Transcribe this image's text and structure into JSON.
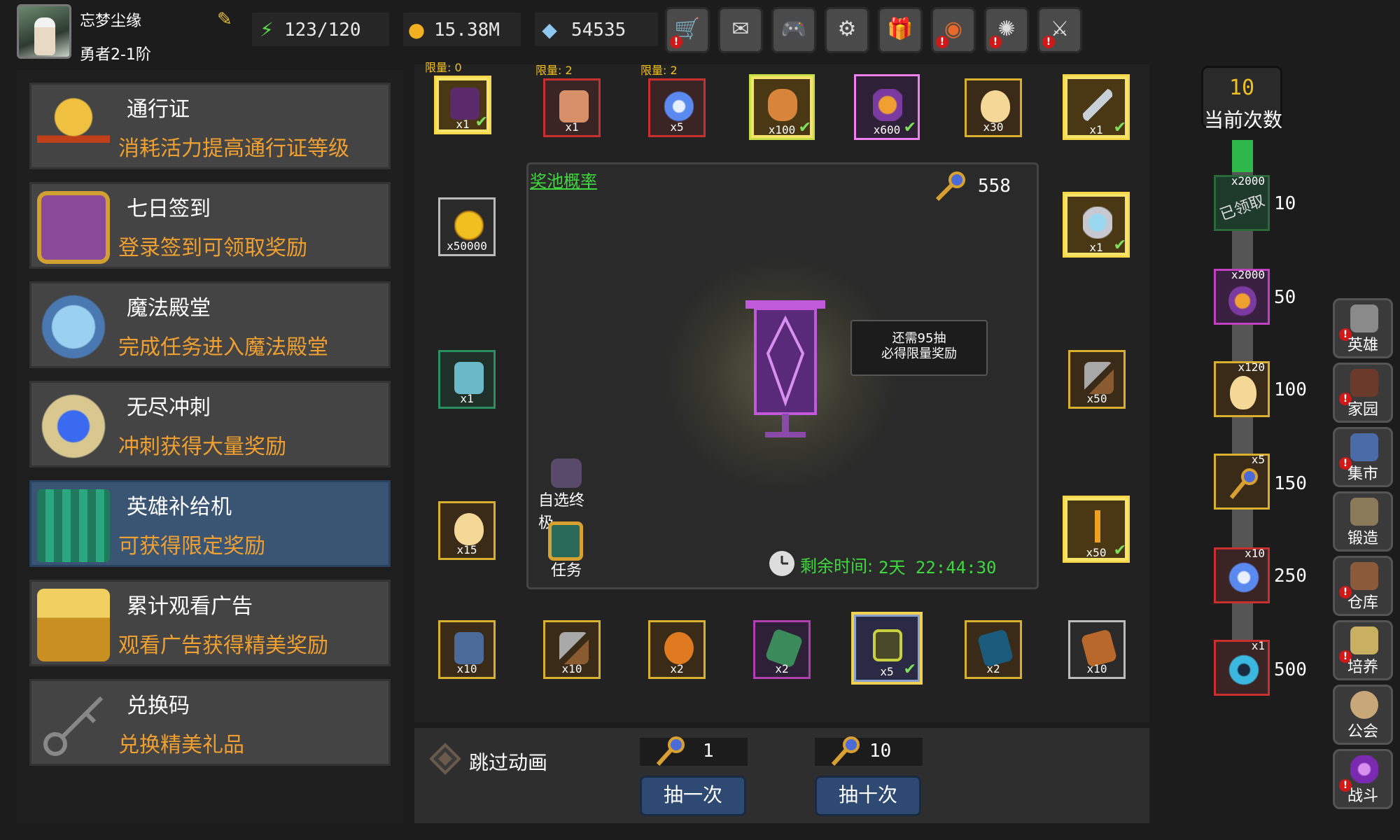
{
  "player": {
    "name": "忘梦尘缘",
    "rank": "勇者2-1阶"
  },
  "resources": [
    {
      "icon": "energy-icon",
      "value": "123/120"
    },
    {
      "icon": "gold-coin-icon",
      "value": "15.38M"
    },
    {
      "icon": "diamond-icon",
      "value": "54535"
    }
  ],
  "top_buttons": [
    "shop-cart-icon",
    "mail-icon",
    "gamepad-icon",
    "settings-gear-icon",
    "gift-icon",
    "color-wheel-icon",
    "fireworks-icon",
    "crossed-swords-icon"
  ],
  "menu": [
    {
      "title": "通行证",
      "desc": "消耗活力提高通行证等级",
      "icon": "goblet-icon"
    },
    {
      "title": "七日签到",
      "desc": "登录签到可领取奖励",
      "icon": "treasure-chest-icon"
    },
    {
      "title": "魔法殿堂",
      "desc": "完成任务进入魔法殿堂",
      "icon": "ice-crystal-icon"
    },
    {
      "title": "无尽冲刺",
      "desc": "冲刺获得大量奖励",
      "icon": "shield-gem-icon"
    },
    {
      "title": "英雄补给机",
      "desc": "可获得限定奖励",
      "icon": "supply-machine-icon"
    },
    {
      "title": "累计观看广告",
      "desc": "观看广告获得精美奖励",
      "icon": "gold-chest-icon"
    },
    {
      "title": "兑换码",
      "desc": "兑换精美礼品",
      "icon": "key-icon"
    }
  ],
  "grid_top": [
    {
      "count": "x1",
      "limit": "限量: 0",
      "claimed": true
    },
    {
      "count": "x1",
      "limit": "限量: 2",
      "claimed": false
    },
    {
      "count": "x5",
      "limit": "限量: 2",
      "claimed": false
    },
    {
      "count": "x100",
      "limit": "",
      "claimed": true
    },
    {
      "count": "x600",
      "limit": "",
      "claimed": true
    },
    {
      "count": "x30",
      "limit": "",
      "claimed": false
    },
    {
      "count": "x1",
      "limit": "",
      "claimed": true
    }
  ],
  "grid_left": [
    "x50000",
    "x1",
    "x15"
  ],
  "grid_right": [
    "x1",
    "x50",
    "x50"
  ],
  "grid_bottom": [
    "x10",
    "x10",
    "x2",
    "x2",
    "x5",
    "x2",
    "x10"
  ],
  "pool": {
    "title": "奖池概率",
    "key_count": "558",
    "tip_line1": "还需95抽",
    "tip_line2": "必得限量奖励",
    "side1": "自选终极",
    "side2": "任务",
    "timer_label": "剩余时间:",
    "timer_value": "2天 22:44:30"
  },
  "draw": {
    "skip_label": "跳过动画",
    "cost_one": "1",
    "cost_ten": "10",
    "btn_one": "抽一次",
    "btn_ten": "抽十次"
  },
  "track": {
    "current": "10",
    "current_label": "当前次数",
    "steps": [
      {
        "count": "x2000",
        "threshold": "10",
        "claimed_label": "已领取"
      },
      {
        "count": "x2000",
        "threshold": "50"
      },
      {
        "count": "x120",
        "threshold": "100"
      },
      {
        "count": "x5",
        "threshold": "150"
      },
      {
        "count": "x10",
        "threshold": "250"
      },
      {
        "count": "x1",
        "threshold": "500"
      }
    ]
  },
  "nav": [
    "英雄",
    "家园",
    "集市",
    "锻造",
    "仓库",
    "培养",
    "公会",
    "战斗"
  ]
}
